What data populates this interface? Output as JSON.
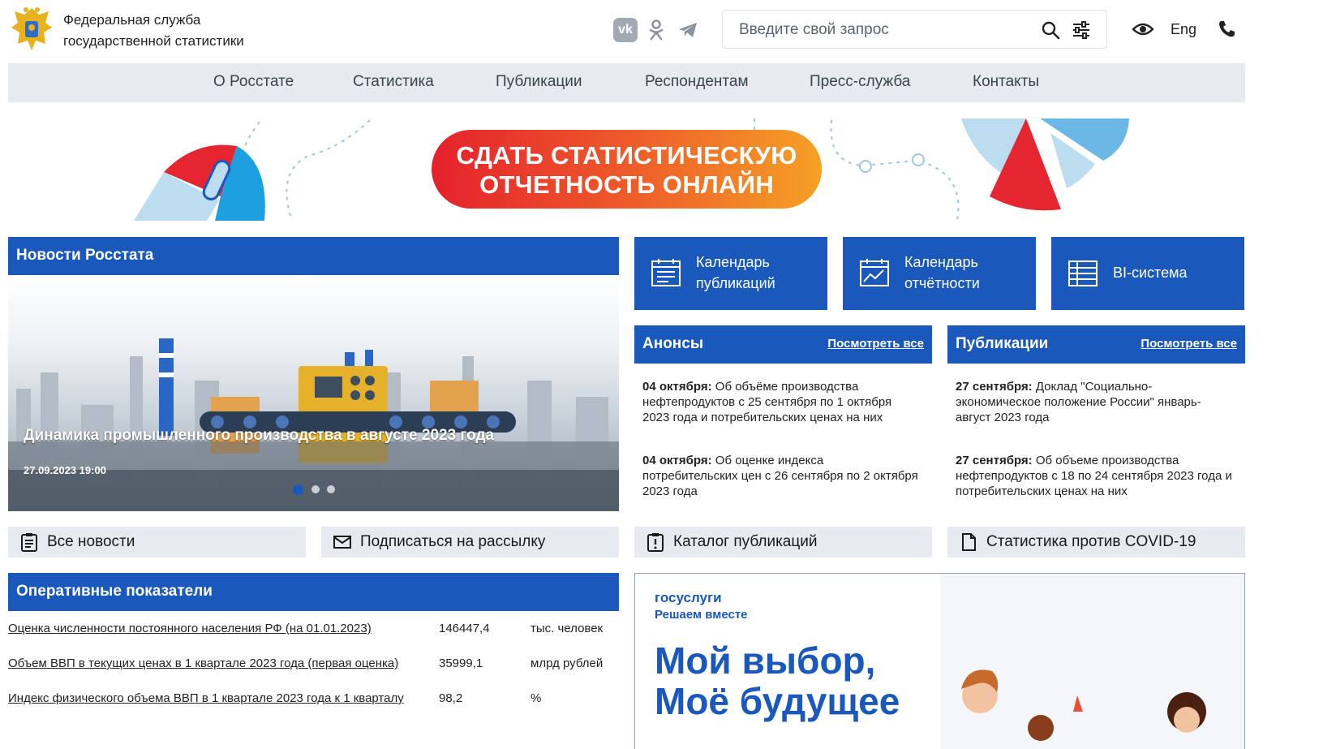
{
  "header": {
    "org_line1": "Федеральная служба",
    "org_line2": "государственной статистики",
    "social": [
      "vk-icon",
      "ok-icon",
      "telegram-icon"
    ],
    "search_placeholder": "Введите свой запрос",
    "lang": "Eng"
  },
  "nav": [
    "О Росстате",
    "Статистика",
    "Публикации",
    "Респондентам",
    "Пресс-служба",
    "Контакты"
  ],
  "banner": {
    "line1": "СДАТЬ СТАТИСТИЧЕСКУЮ",
    "line2": "ОТЧЕТНОСТЬ ОНЛАЙН"
  },
  "news": {
    "title": "Новости Росстата",
    "slide_title": "Динамика промышленного производства в августе 2023 года",
    "slide_date": "27.09.2023 19:00",
    "slides_total": 3,
    "slide_active": 1
  },
  "tiles": [
    {
      "line1": "Календарь",
      "line2": "публикаций",
      "icon": "calendar-list-icon"
    },
    {
      "line1": "Календарь",
      "line2": "отчётности",
      "icon": "calendar-chart-icon"
    },
    {
      "line1": "BI-система",
      "line2": "",
      "icon": "database-table-icon"
    }
  ],
  "announcements": {
    "title": "Анонсы",
    "see_all": "Посмотреть все",
    "items": [
      {
        "date": "04 октября:",
        "text": " Об объёме производства нефтепродуктов с 25 сентября по 1 октября 2023 года и потребительских ценах на них"
      },
      {
        "date": "04 октября:",
        "text": " Об оценке индекса потребительских цен с 26 сентября по 2 октября 2023 года"
      }
    ]
  },
  "publications": {
    "title": "Публикации",
    "see_all": "Посмотреть все",
    "items": [
      {
        "date": "27 сентября:",
        "text": " Доклад \"Социально-экономическое положение России\" январь-август 2023 года"
      },
      {
        "date": "27 сентября:",
        "text": " Об объеме производства нефтепродуктов с 18 по 24 сентября 2023 года и потребительских ценах на них"
      }
    ]
  },
  "buttons": {
    "all_news": "Все новости",
    "subscribe": "Подписаться на рассылку",
    "catalog": "Каталог публикаций",
    "covid": "Статистика против COVID-19"
  },
  "indicators": {
    "title": "Оперативные показатели",
    "rows": [
      {
        "name": "Оценка численности постоянного населения РФ (на 01.01.2023)",
        "value": "146447,4",
        "unit": "тыс. человек"
      },
      {
        "name": "Объем ВВП в текущих ценах в 1 квартале 2023 года (первая оценка)",
        "value": "35999,1",
        "unit": "млрд рублей"
      },
      {
        "name": "Индекс физического объема ВВП в 1 квартале 2023 года к 1 кварталу",
        "value": "98,2",
        "unit": "%"
      }
    ]
  },
  "gosuslugi": {
    "brand": "госуслуги",
    "tagline": "Решаем вместе",
    "headline1": "Мой выбор,",
    "headline2": "Моё будущее"
  },
  "colors": {
    "primary": "#1a58bb",
    "nav_bg": "#e7ebf1",
    "accent_red": "#e5212d",
    "accent_orange": "#f5a125"
  }
}
